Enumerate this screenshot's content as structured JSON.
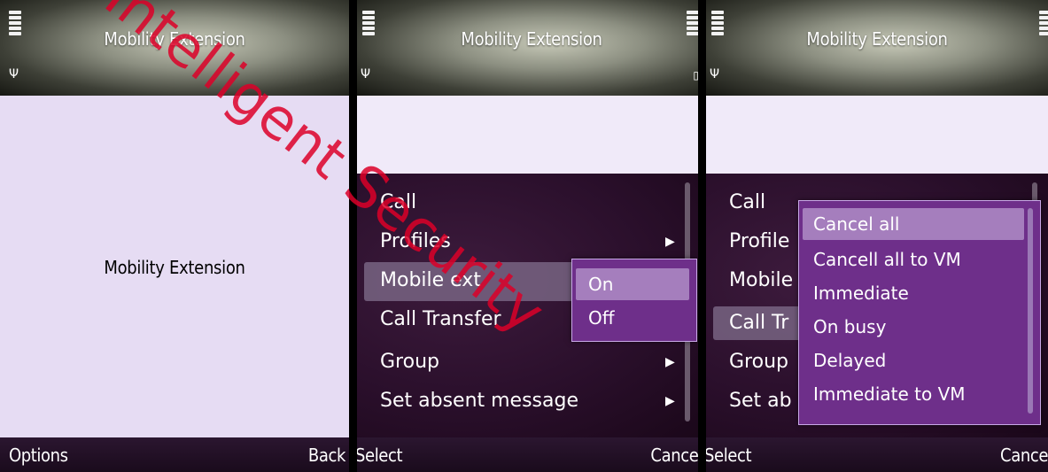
{
  "panels": [
    {
      "title": "Mobility Extension",
      "center_text": "Mobility Extension",
      "softkeys": {
        "left": "Options",
        "right": "Back"
      }
    },
    {
      "title": "Mobility Extension",
      "menu": [
        {
          "label": "Call",
          "submenu": false
        },
        {
          "label": "Profiles",
          "submenu": true
        },
        {
          "label": "Mobile ext",
          "submenu": false,
          "selected": true
        },
        {
          "label": "Call Transfer",
          "submenu": false
        },
        {
          "label": "Group",
          "submenu": true
        },
        {
          "label": "Set absent message",
          "submenu": true
        }
      ],
      "popup": [
        "On",
        "Off"
      ],
      "softkeys": {
        "left": "Select",
        "right": "Cancel"
      }
    },
    {
      "title": "Mobility Extension",
      "menu": [
        {
          "label": "Call"
        },
        {
          "label": "Profile"
        },
        {
          "label": "Mobile"
        },
        {
          "label": "Call Tr"
        },
        {
          "label": "Group"
        },
        {
          "label": "Set ab"
        }
      ],
      "popup": [
        "Cancel all",
        "Cancell all to VM",
        "Immediate",
        "On busy",
        "Delayed",
        "Immediate to VM"
      ],
      "softkeys": {
        "left": "Select",
        "right": "Cance"
      }
    }
  ],
  "watermark": "Intelligent Security",
  "colors": {
    "menu_bg": "#2a0f2b",
    "popup_bg": "#6e2f8a",
    "popup_highlight": "#a57ebd",
    "watermark": "#dc0028"
  }
}
